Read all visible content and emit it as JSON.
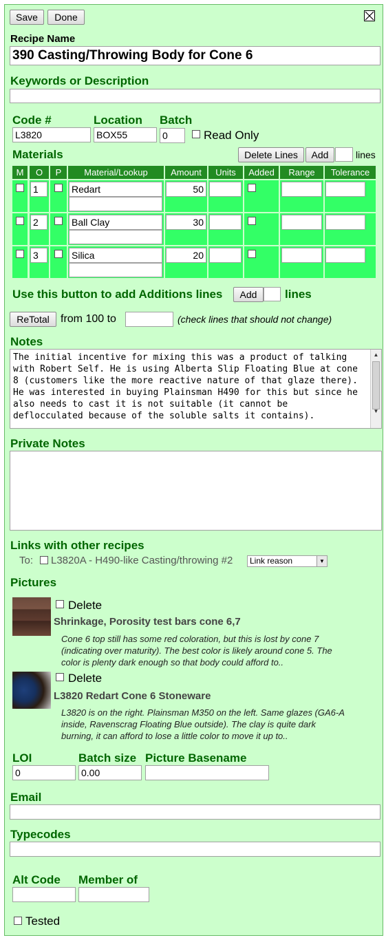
{
  "toolbar": {
    "save_label": "Save",
    "done_label": "Done",
    "close_label": "☒"
  },
  "recipe": {
    "name_label": "Recipe Name",
    "name_value": "390 Casting/Throwing Body for Cone 6"
  },
  "keywords": {
    "label": "Keywords or Description",
    "value": ""
  },
  "meta": {
    "code_label": "Code #",
    "code_value": "L3820",
    "location_label": "Location",
    "location_value": "BOX55",
    "batch_label": "Batch",
    "batch_value": "0",
    "readonly_label": "Read Only"
  },
  "materials": {
    "label": "Materials",
    "delete_lines_label": "Delete Lines",
    "add_label": "Add",
    "lines_label": "lines",
    "headers": [
      "M",
      "O",
      "P",
      "Material/Lookup",
      "Amount",
      "Units",
      "Added",
      "Range",
      "Tolerance"
    ],
    "rows": [
      {
        "order": "1",
        "material": "Redart",
        "amount": "50"
      },
      {
        "order": "2",
        "material": "Ball Clay",
        "amount": "30"
      },
      {
        "order": "3",
        "material": "Silica",
        "amount": "20"
      }
    ]
  },
  "additions": {
    "text": "Use this button to add Additions lines",
    "add_label": "Add",
    "lines_label": "lines"
  },
  "retotal": {
    "button_label": "ReTotal",
    "from_text": "from 100 to",
    "note": "(check lines that should not change)"
  },
  "notes": {
    "label": "Notes",
    "lines": [
      "The initial incentive for mixing this was a product of talking",
      "with Robert Self. He is using Alberta Slip Floating Blue at cone",
      "8 (customers like the more reactive nature of that glaze there).",
      "He was interested in buying Plainsman H490 for this but since he",
      "also needs to cast it is not suitable (it cannot be",
      "deflocculated because of the soluble salts it contains)."
    ]
  },
  "private_notes": {
    "label": "Private Notes",
    "value": ""
  },
  "links": {
    "label": "Links with other recipes",
    "to_label": "To:",
    "item": "L3820A - H490-like Casting/throwing #2",
    "select_value": "Link reason"
  },
  "pictures": {
    "label": "Pictures",
    "delete_label": "Delete",
    "items": [
      {
        "title": "Shrinkage, Porosity test bars cone 6,7",
        "desc": [
          "Cone 6 top still has some red coloration, but this is lost by cone 7",
          "(indicating over maturity). The best color is likely around cone 5. The",
          "color is plenty dark enough so that body could afford to.."
        ]
      },
      {
        "title": "L3820 Redart Cone 6 Stoneware",
        "desc": [
          "L3820 is on the right. Plainsman M350 on the left. Same glazes (GA6-A",
          "inside, Ravenscrag Floating Blue outside). The clay is quite dark",
          "burning, it can afford to lose a little color to move it up to.."
        ]
      }
    ]
  },
  "bottom": {
    "loi_label": "LOI",
    "loi_value": "0",
    "batch_size_label": "Batch size",
    "batch_size_value": "0.00",
    "basename_label": "Picture Basename",
    "basename_value": "",
    "email_label": "Email",
    "email_value": "",
    "typecodes_label": "Typecodes",
    "typecodes_value": "",
    "altcode_label": "Alt Code",
    "altcode_value": "",
    "memberof_label": "Member of",
    "memberof_value": "",
    "tested_label": "Tested"
  }
}
